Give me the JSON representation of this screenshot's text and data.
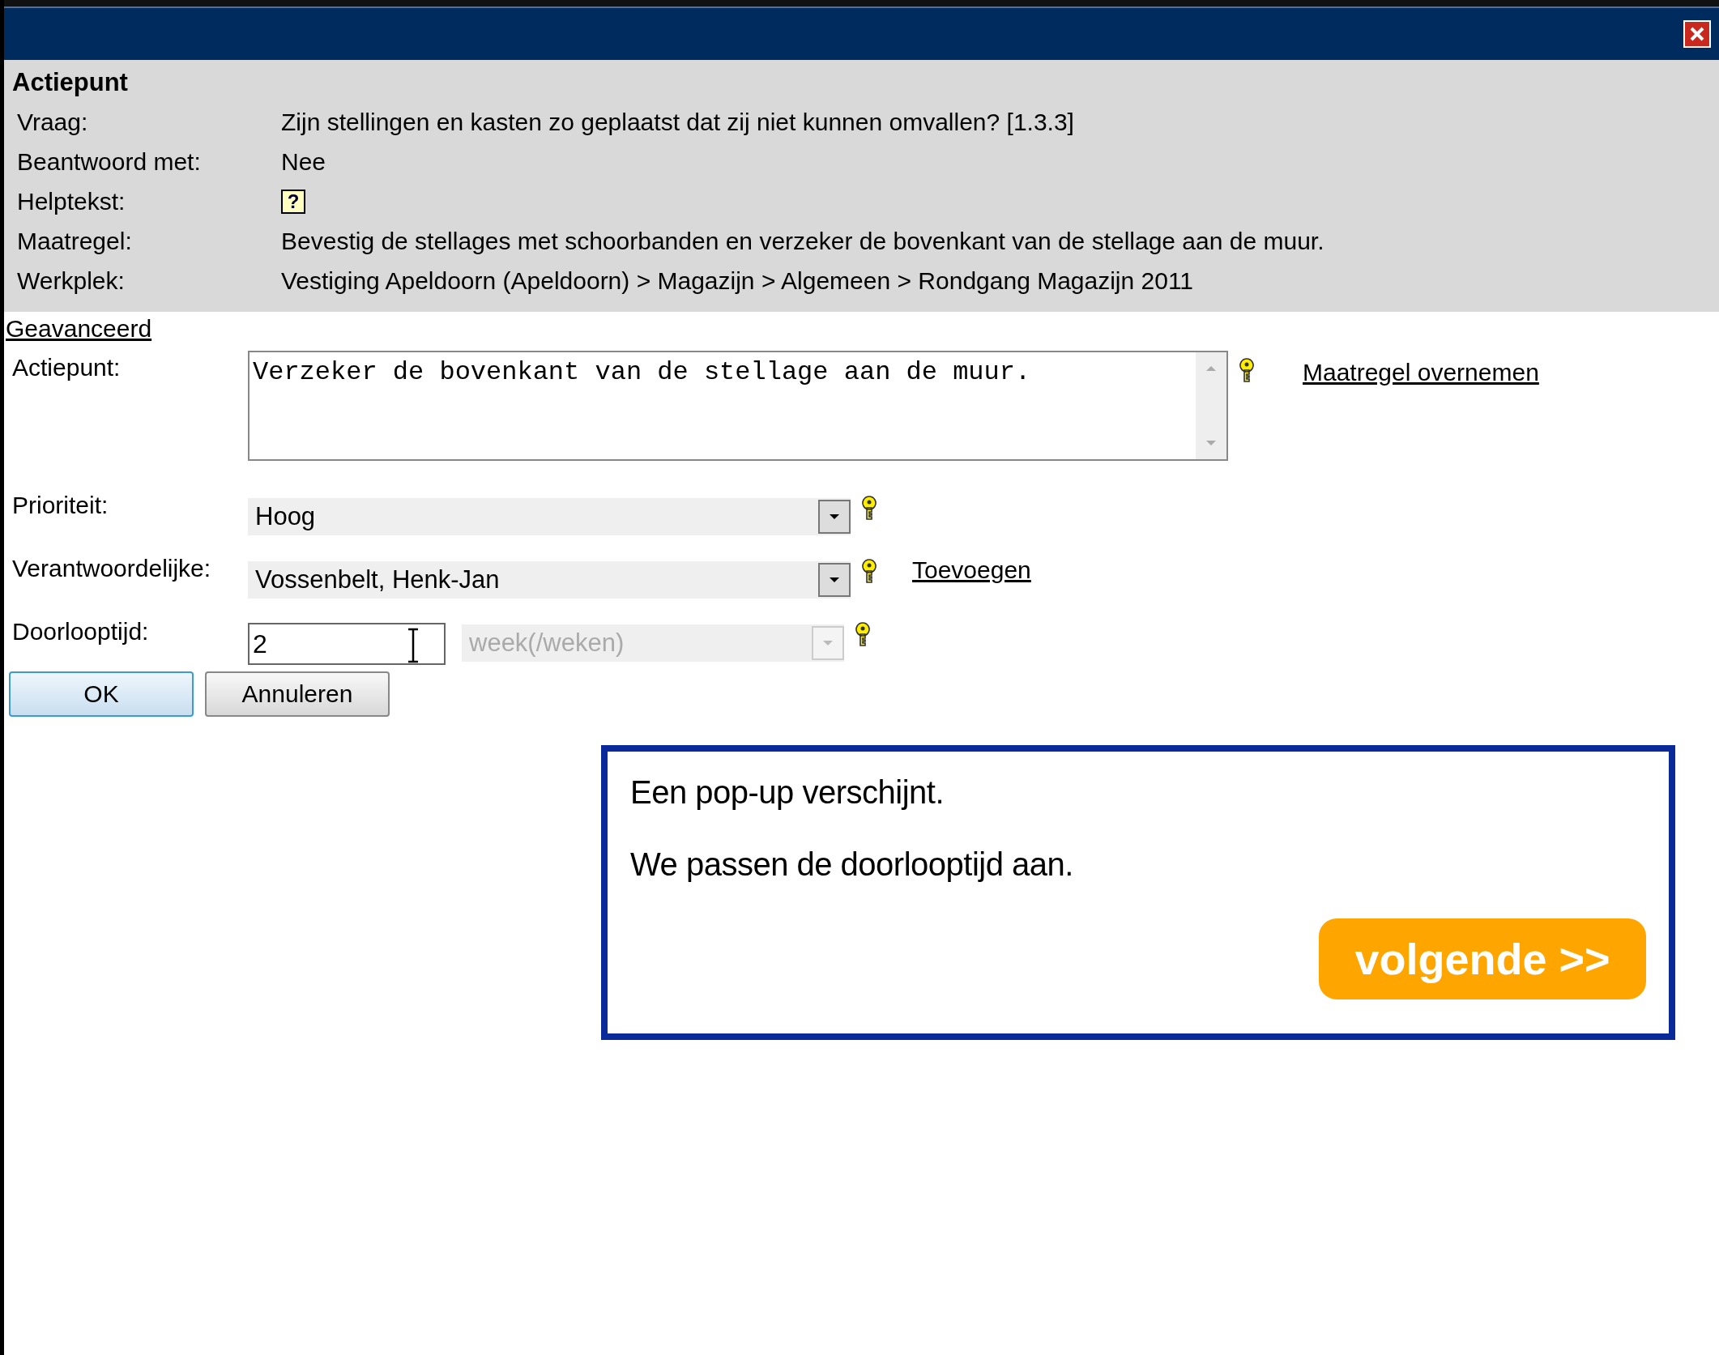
{
  "header": {
    "title": "Actiepunt",
    "fields": [
      {
        "label": "Vraag:",
        "value": "Zijn stellingen en kasten zo geplaatst dat zij niet kunnen omvallen? [1.3.3]",
        "kind": "text"
      },
      {
        "label": "Beantwoord met:",
        "value": "Nee",
        "kind": "text"
      },
      {
        "label": "Helptekst:",
        "value": "?",
        "kind": "help"
      },
      {
        "label": "Maatregel:",
        "value": "Bevestig de stellages met schoorbanden en verzeker de bovenkant van de stellage aan de muur.",
        "kind": "text"
      },
      {
        "label": "Werkplek:",
        "value": "Vestiging Apeldoorn (Apeldoorn) > Magazijn > Algemeen > Rondgang Magazijn 2011",
        "kind": "text"
      }
    ]
  },
  "advanced_link": "Geavanceerd",
  "form": [
    {
      "label": "Actiepunt:",
      "kind": "textarea",
      "value": "Verzeker de bovenkant van de stellage aan de muur.",
      "link": "Maatregel overnemen"
    },
    {
      "label": "Prioriteit:",
      "kind": "select",
      "value": "Hoog"
    },
    {
      "label": "Verantwoordelijke:",
      "kind": "select",
      "value": "Vossenbelt, Henk-Jan",
      "link": "Toevoegen"
    },
    {
      "label": "Doorlooptijd:",
      "kind": "duration",
      "value": "2",
      "unit": "week(/weken)",
      "unit_disabled": true
    }
  ],
  "buttons": [
    {
      "label": "OK",
      "focused": true
    },
    {
      "label": "Annuleren",
      "focused": false
    }
  ],
  "popup": {
    "lines": [
      "Een pop-up verschijnt.",
      "We passen de doorlooptijd aan."
    ],
    "next_button": "volgende >>"
  }
}
